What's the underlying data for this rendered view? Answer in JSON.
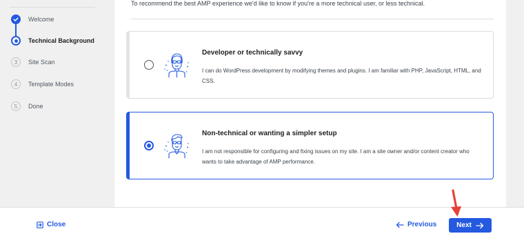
{
  "steps": [
    {
      "number": "",
      "label": "Welcome",
      "state": "done"
    },
    {
      "number": "",
      "label": "Technical Background",
      "state": "current"
    },
    {
      "number": "3",
      "label": "Site Scan",
      "state": "upcoming"
    },
    {
      "number": "4",
      "label": "Template Modes",
      "state": "upcoming"
    },
    {
      "number": "5",
      "label": "Done",
      "state": "upcoming"
    }
  ],
  "intro_text": "To recommend the best AMP experience we'd like to know if you're a more technical user, or less technical.",
  "options": [
    {
      "title": "Developer or technically savvy",
      "description": "I can do WordPress development by modifying themes and plugins. I am familiar with PHP, JavaScript, HTML, and CSS.",
      "selected": false,
      "icon": "developer-icon"
    },
    {
      "title": "Non-technical or wanting a simpler setup",
      "description": "I am not responsible for configuring and fixing issues on my site. I am a site owner and/or content creator who wants to take advantage of AMP performance.",
      "selected": true,
      "icon": "non-technical-user-icon"
    }
  ],
  "footer": {
    "close_label": "Close",
    "previous_label": "Previous",
    "next_label": "Next"
  },
  "colors": {
    "accent": "#2459e0",
    "annotation": "#e8413a"
  }
}
